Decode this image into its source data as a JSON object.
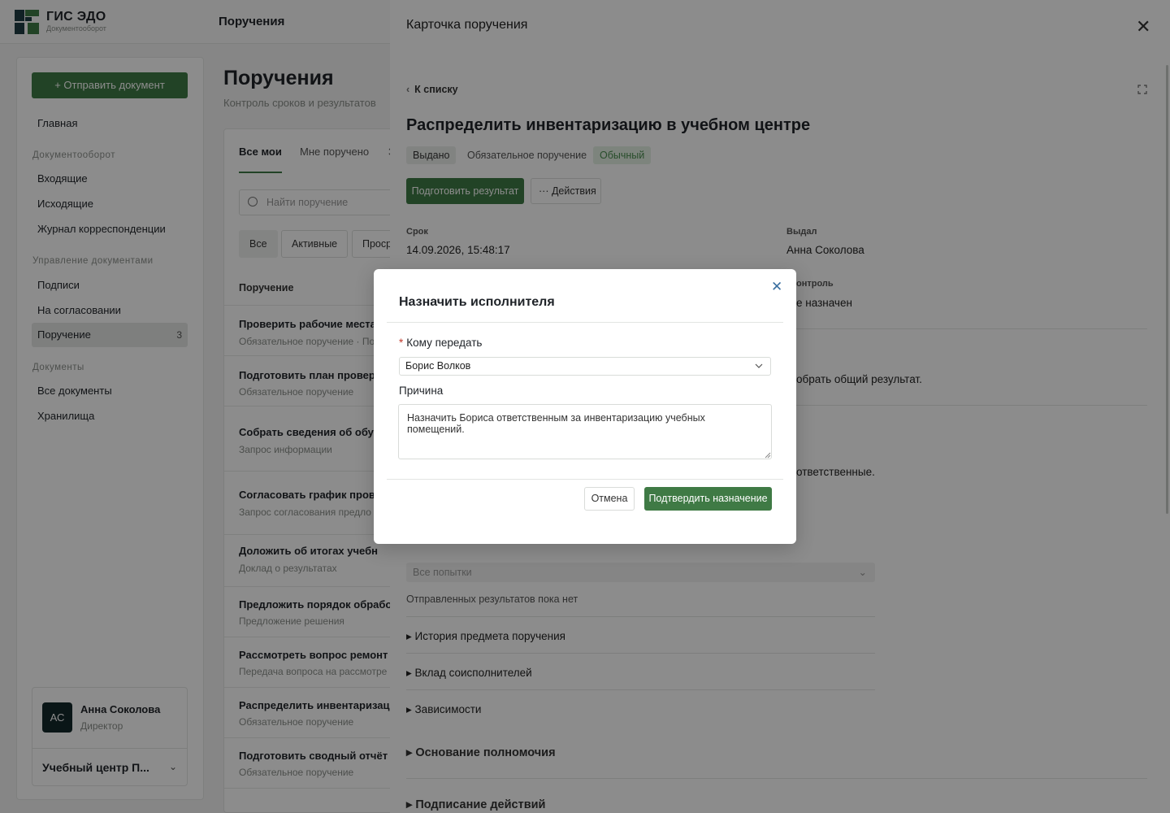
{
  "app": {
    "name": "ГИС ЭДО",
    "subtitle": "Документооборот",
    "section_title": "Поручения"
  },
  "sidebar": {
    "send_button": "+ Отправить документ",
    "home": "Главная",
    "section_docflow": "Документооборот",
    "incoming": "Входящие",
    "outgoing": "Исходящие",
    "journal": "Журнал корреспонденции",
    "section_management": "Управление документами",
    "signatures": "Подписи",
    "approval": "На согласовании",
    "assignments": "Поручение",
    "assignments_count": "3",
    "section_documents": "Документы",
    "all_documents": "Все документы",
    "storages": "Хранилища",
    "user": {
      "initials": "АС",
      "name": "Анна Соколова",
      "role": "Директор",
      "org": "Учебный центр П..."
    }
  },
  "main": {
    "title": "Поручения",
    "subtitle": "Контроль сроков и результатов",
    "tabs": [
      "Все мои",
      "Мне поручено",
      "З"
    ],
    "search_placeholder": "Найти поручение",
    "filters": [
      "Все",
      "Активные",
      "Проср"
    ],
    "column_header": "Поручение",
    "rows": [
      {
        "title": "Проверить рабочие места",
        "sub": "Обязательное поручение · По"
      },
      {
        "title": "Подготовить план провер",
        "sub": "Обязательное поручение"
      },
      {
        "title": "Собрать сведения об обу",
        "sub": "Запрос информации"
      },
      {
        "title": "Согласовать график пров",
        "sub": "Запрос согласования предло"
      },
      {
        "title": "Доложить об итогах учебн",
        "sub": "Доклад о результатах"
      },
      {
        "title": "Предложить порядок обрабо",
        "sub": "Предложение решения"
      },
      {
        "title": "Рассмотреть вопрос ремонт",
        "sub": "Передача вопроса на рассмотре"
      },
      {
        "title": "Распределить инвентаризац",
        "sub": "Обязательное поручение"
      },
      {
        "title": "Подготовить сводный отчёт",
        "sub": "Обязательное поручение"
      }
    ]
  },
  "drawer": {
    "title": "Карточка поручения",
    "back": "К списку",
    "task_title": "Распределить инвентаризацию в учебном центре",
    "status": "Выдано",
    "type": "Обязательное поручение",
    "priority": "Обычный",
    "prepare_button": "Подготовить результат",
    "actions_button": "··· Действия",
    "deadline_label": "Срок",
    "deadline_value": "14.09.2026, 15:48:17",
    "issuer_label": "Выдал",
    "issuer_value": "Анна Соколова",
    "control_label": "онтроль",
    "control_value": "е назначен",
    "text_1": "обрать общий результат.",
    "text_2": "ответственные.",
    "attempts_placeholder": "Все попытки",
    "no_results": "Отправленных результатов пока нет",
    "history": "История предмета поручения",
    "coexecutors": "Вклад соисполнителей",
    "dependencies": "Зависимости",
    "authority": "Основание полномочия",
    "signing": "Подписание действий"
  },
  "modal": {
    "title": "Назначить исполнителя",
    "recipient_label": "Кому передать",
    "recipient_value": "Борис Волков",
    "reason_label": "Причина",
    "reason_value": "Назначить Бориса ответственным за инвентаризацию учебных помещений.",
    "cancel": "Отмена",
    "confirm": "Подтвердить назначение"
  },
  "colors": {
    "primary": "#3f7a45",
    "overlay": "rgba(0,0,0,0.45)",
    "required": "#c0392b",
    "close_icon": "#3a6fa0"
  }
}
